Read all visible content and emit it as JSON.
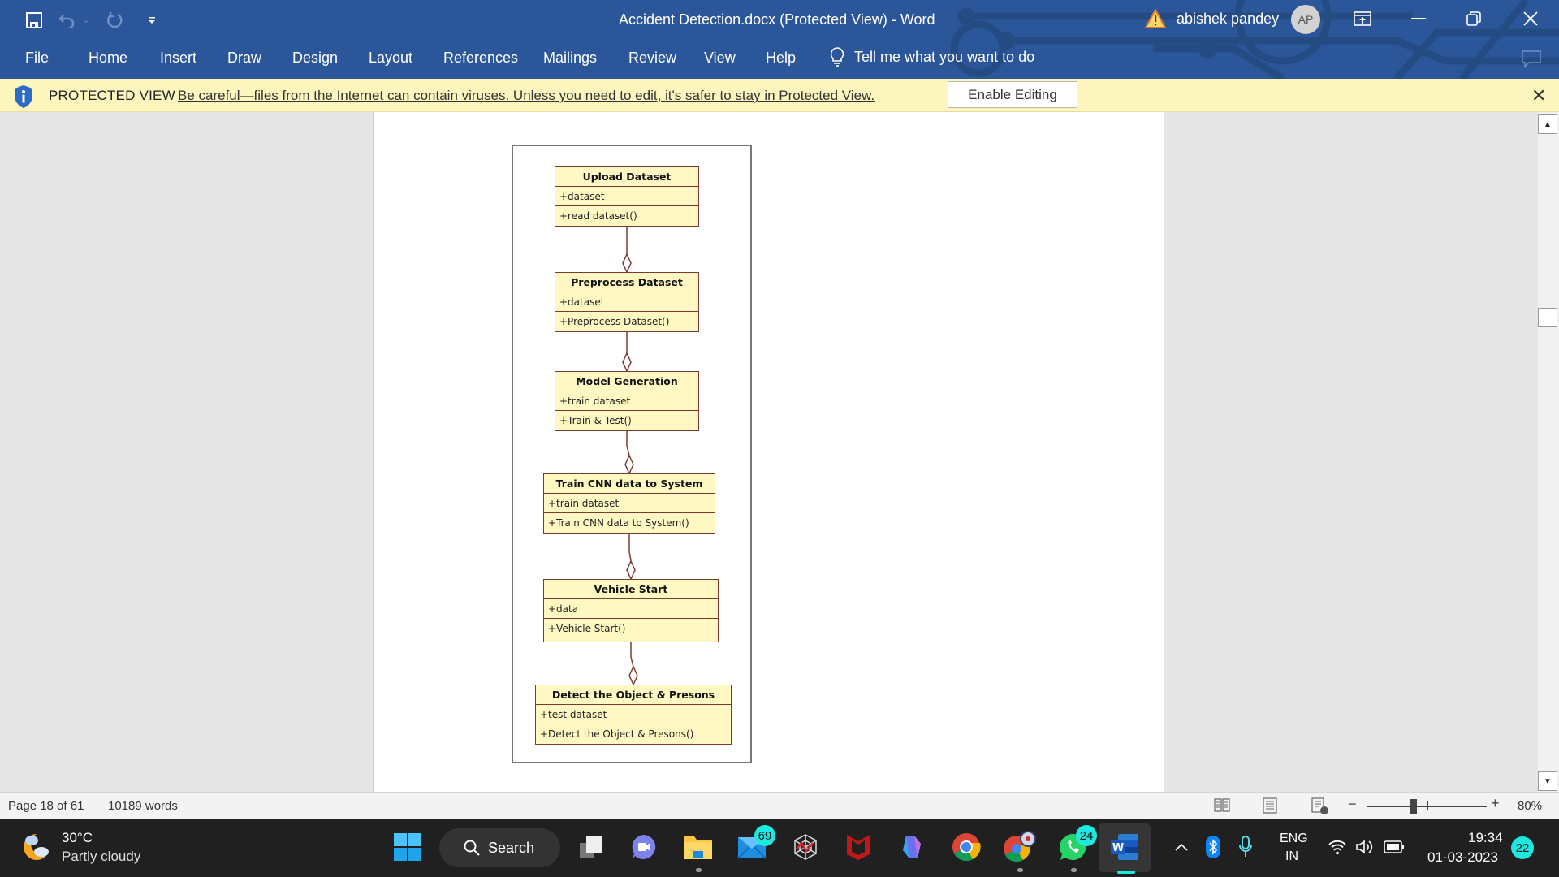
{
  "app": {
    "title": "Accident Detection.docx (Protected View)  -  Word",
    "user_name": "abishek pandey",
    "user_initials": "AP",
    "accent_color": "#2b579a"
  },
  "quick_access": [
    {
      "name": "save",
      "icon": "save-icon"
    },
    {
      "name": "undo",
      "icon": "undo-icon"
    },
    {
      "name": "redo",
      "icon": "redo-icon"
    },
    {
      "name": "customize",
      "icon": "customize-qat-icon"
    }
  ],
  "ribbon": {
    "tabs": [
      {
        "label": "File"
      },
      {
        "label": "Home"
      },
      {
        "label": "Insert"
      },
      {
        "label": "Draw"
      },
      {
        "label": "Design"
      },
      {
        "label": "Layout"
      },
      {
        "label": "References"
      },
      {
        "label": "Mailings"
      },
      {
        "label": "Review"
      },
      {
        "label": "View"
      },
      {
        "label": "Help"
      }
    ],
    "tell_me": "Tell me what you want to do"
  },
  "protected_view": {
    "label": "PROTECTED VIEW",
    "message": "Be careful—files from the Internet can contain viruses. Unless you need to edit, it's safer to stay in Protected View.",
    "button": "Enable Editing",
    "bg_color": "#fdf5be"
  },
  "diagram": {
    "classes": [
      {
        "name": "Upload Dataset",
        "attribute": "+dataset",
        "method": "+read dataset()"
      },
      {
        "name": "Preprocess Dataset",
        "attribute": "+dataset",
        "method": "+Preprocess Dataset()"
      },
      {
        "name": "Model Generation",
        "attribute": "+train dataset",
        "method": "+Train & Test()"
      },
      {
        "name": "Train CNN data to System",
        "attribute": "+train dataset",
        "method": "+Train CNN data to System()"
      },
      {
        "name": "Vehicle Start",
        "attribute": "+data",
        "method": "+Vehicle Start()"
      },
      {
        "name": "Detect the Object & Presons",
        "attribute": "+test dataset",
        "method": "+Detect the Object & Presons()"
      }
    ],
    "relationship": "aggregation",
    "box_fill": "#fff8c2",
    "box_border": "#7d3a2e"
  },
  "status": {
    "page": "Page 18 of 61",
    "words": "10189 words",
    "zoom": "80%",
    "zoom_level_percent": 80
  },
  "taskbar": {
    "weather_temp": "30°C",
    "weather_desc": "Partly cloudy",
    "search_label": "Search",
    "mail_badge": "69",
    "whatsapp_badge": "24",
    "lang_line1": "ENG",
    "lang_line2": "IN",
    "time": "19:34",
    "date": "01-03-2023",
    "notification_count": "22"
  }
}
